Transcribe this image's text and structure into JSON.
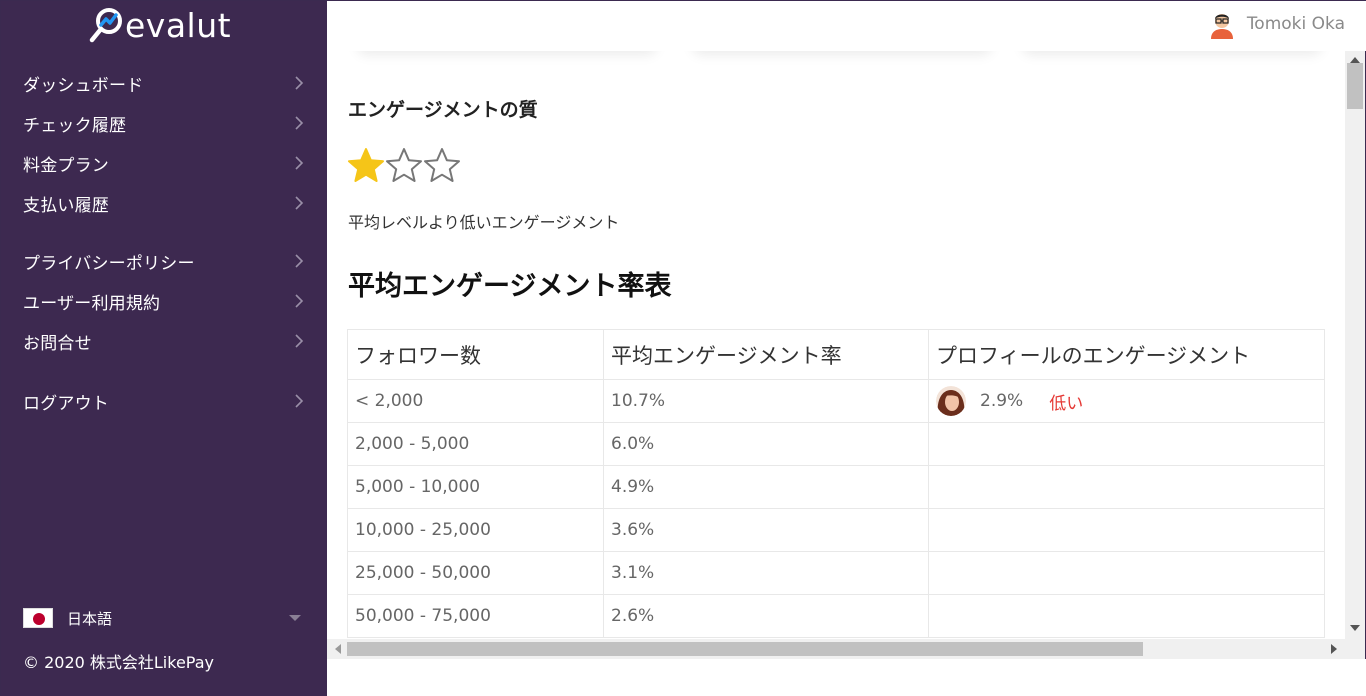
{
  "brand": {
    "name": "evalut"
  },
  "sidebar": {
    "items_group1": [
      {
        "label": "ダッシュボード"
      },
      {
        "label": "チェック履歴"
      },
      {
        "label": "料金プラン"
      },
      {
        "label": "支払い履歴"
      }
    ],
    "items_group2": [
      {
        "label": "プライバシーポリシー"
      },
      {
        "label": "ユーザー利用規約"
      },
      {
        "label": "お問合せ"
      }
    ],
    "items_group3": [
      {
        "label": "ログアウト"
      }
    ],
    "language": {
      "selected": "日本語"
    },
    "copyright": "© 2020 株式会社LikePay"
  },
  "header": {
    "user_name": "Tomoki Oka"
  },
  "main": {
    "quality": {
      "title": "エンゲージメントの質",
      "rating": 1,
      "rating_max": 3,
      "description": "平均レベルより低いエンゲージメント"
    },
    "table": {
      "title": "平均エンゲージメント率表",
      "headers": [
        "フォロワー数",
        "平均エンゲージメント率",
        "プロフィールのエンゲージメント"
      ],
      "rows": [
        {
          "followers": "< 2,000",
          "avg_rate": "10.7%",
          "profile_rate": "2.9%",
          "profile_status": "低い"
        },
        {
          "followers": "2,000 - 5,000",
          "avg_rate": "6.0%",
          "profile_rate": "",
          "profile_status": ""
        },
        {
          "followers": "5,000 - 10,000",
          "avg_rate": "4.9%",
          "profile_rate": "",
          "profile_status": ""
        },
        {
          "followers": "10,000 - 25,000",
          "avg_rate": "3.6%",
          "profile_rate": "",
          "profile_status": ""
        },
        {
          "followers": "25,000 - 50,000",
          "avg_rate": "3.1%",
          "profile_rate": "",
          "profile_status": ""
        },
        {
          "followers": "50,000 - 75,000",
          "avg_rate": "2.6%",
          "profile_rate": "",
          "profile_status": ""
        }
      ]
    }
  },
  "colors": {
    "sidebar_bg": "#3d2950",
    "star_filled": "#f5c518",
    "status_low": "#e53935",
    "logo_accent": "#2196f3"
  },
  "icons": {
    "chevron": "chevron-right-icon",
    "star_filled": "star-filled-icon",
    "star_empty": "star-outline-icon"
  }
}
